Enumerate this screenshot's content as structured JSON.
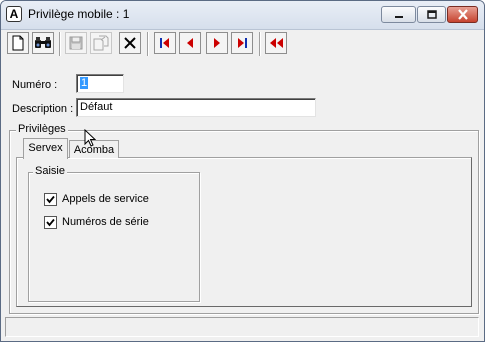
{
  "window": {
    "title": "Privilège mobile : 1",
    "app_icon_letter": "A"
  },
  "toolbar": {
    "buttons": [
      {
        "name": "new-icon",
        "enabled": true
      },
      {
        "name": "search-icon",
        "enabled": true
      },
      {
        "name": "save-icon",
        "enabled": false
      },
      {
        "name": "copy-icon",
        "enabled": false
      },
      {
        "name": "delete-icon",
        "enabled": true
      },
      {
        "name": "first-record-icon",
        "enabled": true
      },
      {
        "name": "previous-record-icon",
        "enabled": true
      },
      {
        "name": "next-record-icon",
        "enabled": true
      },
      {
        "name": "last-record-icon",
        "enabled": true
      },
      {
        "name": "rewind-icon",
        "enabled": true
      }
    ],
    "nav_color": "#cc0000",
    "nav_bar_color": "#1030b0"
  },
  "form": {
    "numero_label": "Numéro :",
    "numero_value": "1",
    "description_label": "Description :",
    "description_value": "Défaut"
  },
  "privileges": {
    "group_label": "Privilèges",
    "tabs": [
      {
        "label": "Servex",
        "active": true
      },
      {
        "label": "Acomba",
        "active": false
      }
    ],
    "saisie": {
      "label": "Saisie",
      "options": [
        {
          "label": "Appels de service",
          "checked": true
        },
        {
          "label": "Numéros de série",
          "checked": true
        }
      ]
    }
  }
}
